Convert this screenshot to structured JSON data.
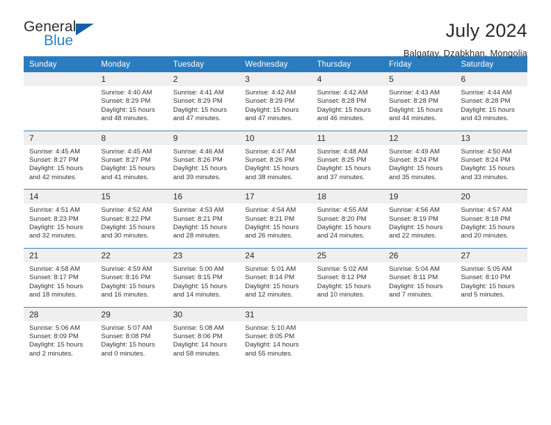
{
  "brand": {
    "name_part1": "General",
    "name_part2": "Blue",
    "accent_color": "#2a7fc1",
    "triangle_color": "#1461a8"
  },
  "header": {
    "title": "July 2024",
    "location": "Balgatay, Dzabkhan, Mongolia"
  },
  "calendar": {
    "header_color": "#2b7cbf",
    "daynum_band_color": "#efefef",
    "weekdays": [
      "Sunday",
      "Monday",
      "Tuesday",
      "Wednesday",
      "Thursday",
      "Friday",
      "Saturday"
    ],
    "weeks": [
      [
        {
          "day": "",
          "empty": true,
          "sunrise": "",
          "sunset": "",
          "daylight1": "",
          "daylight2": ""
        },
        {
          "day": "1",
          "sunrise": "Sunrise: 4:40 AM",
          "sunset": "Sunset: 8:29 PM",
          "daylight1": "Daylight: 15 hours",
          "daylight2": "and 48 minutes."
        },
        {
          "day": "2",
          "sunrise": "Sunrise: 4:41 AM",
          "sunset": "Sunset: 8:29 PM",
          "daylight1": "Daylight: 15 hours",
          "daylight2": "and 47 minutes."
        },
        {
          "day": "3",
          "sunrise": "Sunrise: 4:42 AM",
          "sunset": "Sunset: 8:29 PM",
          "daylight1": "Daylight: 15 hours",
          "daylight2": "and 47 minutes."
        },
        {
          "day": "4",
          "sunrise": "Sunrise: 4:42 AM",
          "sunset": "Sunset: 8:28 PM",
          "daylight1": "Daylight: 15 hours",
          "daylight2": "and 46 minutes."
        },
        {
          "day": "5",
          "sunrise": "Sunrise: 4:43 AM",
          "sunset": "Sunset: 8:28 PM",
          "daylight1": "Daylight: 15 hours",
          "daylight2": "and 44 minutes."
        },
        {
          "day": "6",
          "sunrise": "Sunrise: 4:44 AM",
          "sunset": "Sunset: 8:28 PM",
          "daylight1": "Daylight: 15 hours",
          "daylight2": "and 43 minutes."
        }
      ],
      [
        {
          "day": "7",
          "sunrise": "Sunrise: 4:45 AM",
          "sunset": "Sunset: 8:27 PM",
          "daylight1": "Daylight: 15 hours",
          "daylight2": "and 42 minutes."
        },
        {
          "day": "8",
          "sunrise": "Sunrise: 4:45 AM",
          "sunset": "Sunset: 8:27 PM",
          "daylight1": "Daylight: 15 hours",
          "daylight2": "and 41 minutes."
        },
        {
          "day": "9",
          "sunrise": "Sunrise: 4:46 AM",
          "sunset": "Sunset: 8:26 PM",
          "daylight1": "Daylight: 15 hours",
          "daylight2": "and 39 minutes."
        },
        {
          "day": "10",
          "sunrise": "Sunrise: 4:47 AM",
          "sunset": "Sunset: 8:26 PM",
          "daylight1": "Daylight: 15 hours",
          "daylight2": "and 38 minutes."
        },
        {
          "day": "11",
          "sunrise": "Sunrise: 4:48 AM",
          "sunset": "Sunset: 8:25 PM",
          "daylight1": "Daylight: 15 hours",
          "daylight2": "and 37 minutes."
        },
        {
          "day": "12",
          "sunrise": "Sunrise: 4:49 AM",
          "sunset": "Sunset: 8:24 PM",
          "daylight1": "Daylight: 15 hours",
          "daylight2": "and 35 minutes."
        },
        {
          "day": "13",
          "sunrise": "Sunrise: 4:50 AM",
          "sunset": "Sunset: 8:24 PM",
          "daylight1": "Daylight: 15 hours",
          "daylight2": "and 33 minutes."
        }
      ],
      [
        {
          "day": "14",
          "sunrise": "Sunrise: 4:51 AM",
          "sunset": "Sunset: 8:23 PM",
          "daylight1": "Daylight: 15 hours",
          "daylight2": "and 32 minutes."
        },
        {
          "day": "15",
          "sunrise": "Sunrise: 4:52 AM",
          "sunset": "Sunset: 8:22 PM",
          "daylight1": "Daylight: 15 hours",
          "daylight2": "and 30 minutes."
        },
        {
          "day": "16",
          "sunrise": "Sunrise: 4:53 AM",
          "sunset": "Sunset: 8:21 PM",
          "daylight1": "Daylight: 15 hours",
          "daylight2": "and 28 minutes."
        },
        {
          "day": "17",
          "sunrise": "Sunrise: 4:54 AM",
          "sunset": "Sunset: 8:21 PM",
          "daylight1": "Daylight: 15 hours",
          "daylight2": "and 26 minutes."
        },
        {
          "day": "18",
          "sunrise": "Sunrise: 4:55 AM",
          "sunset": "Sunset: 8:20 PM",
          "daylight1": "Daylight: 15 hours",
          "daylight2": "and 24 minutes."
        },
        {
          "day": "19",
          "sunrise": "Sunrise: 4:56 AM",
          "sunset": "Sunset: 8:19 PM",
          "daylight1": "Daylight: 15 hours",
          "daylight2": "and 22 minutes."
        },
        {
          "day": "20",
          "sunrise": "Sunrise: 4:57 AM",
          "sunset": "Sunset: 8:18 PM",
          "daylight1": "Daylight: 15 hours",
          "daylight2": "and 20 minutes."
        }
      ],
      [
        {
          "day": "21",
          "sunrise": "Sunrise: 4:58 AM",
          "sunset": "Sunset: 8:17 PM",
          "daylight1": "Daylight: 15 hours",
          "daylight2": "and 18 minutes."
        },
        {
          "day": "22",
          "sunrise": "Sunrise: 4:59 AM",
          "sunset": "Sunset: 8:16 PM",
          "daylight1": "Daylight: 15 hours",
          "daylight2": "and 16 minutes."
        },
        {
          "day": "23",
          "sunrise": "Sunrise: 5:00 AM",
          "sunset": "Sunset: 8:15 PM",
          "daylight1": "Daylight: 15 hours",
          "daylight2": "and 14 minutes."
        },
        {
          "day": "24",
          "sunrise": "Sunrise: 5:01 AM",
          "sunset": "Sunset: 8:14 PM",
          "daylight1": "Daylight: 15 hours",
          "daylight2": "and 12 minutes."
        },
        {
          "day": "25",
          "sunrise": "Sunrise: 5:02 AM",
          "sunset": "Sunset: 8:12 PM",
          "daylight1": "Daylight: 15 hours",
          "daylight2": "and 10 minutes."
        },
        {
          "day": "26",
          "sunrise": "Sunrise: 5:04 AM",
          "sunset": "Sunset: 8:11 PM",
          "daylight1": "Daylight: 15 hours",
          "daylight2": "and 7 minutes."
        },
        {
          "day": "27",
          "sunrise": "Sunrise: 5:05 AM",
          "sunset": "Sunset: 8:10 PM",
          "daylight1": "Daylight: 15 hours",
          "daylight2": "and 5 minutes."
        }
      ],
      [
        {
          "day": "28",
          "sunrise": "Sunrise: 5:06 AM",
          "sunset": "Sunset: 8:09 PM",
          "daylight1": "Daylight: 15 hours",
          "daylight2": "and 2 minutes."
        },
        {
          "day": "29",
          "sunrise": "Sunrise: 5:07 AM",
          "sunset": "Sunset: 8:08 PM",
          "daylight1": "Daylight: 15 hours",
          "daylight2": "and 0 minutes."
        },
        {
          "day": "30",
          "sunrise": "Sunrise: 5:08 AM",
          "sunset": "Sunset: 8:06 PM",
          "daylight1": "Daylight: 14 hours",
          "daylight2": "and 58 minutes."
        },
        {
          "day": "31",
          "sunrise": "Sunrise: 5:10 AM",
          "sunset": "Sunset: 8:05 PM",
          "daylight1": "Daylight: 14 hours",
          "daylight2": "and 55 minutes."
        },
        {
          "day": "",
          "empty": true,
          "sunrise": "",
          "sunset": "",
          "daylight1": "",
          "daylight2": ""
        },
        {
          "day": "",
          "empty": true,
          "sunrise": "",
          "sunset": "",
          "daylight1": "",
          "daylight2": ""
        },
        {
          "day": "",
          "empty": true,
          "sunrise": "",
          "sunset": "",
          "daylight1": "",
          "daylight2": ""
        }
      ]
    ]
  }
}
